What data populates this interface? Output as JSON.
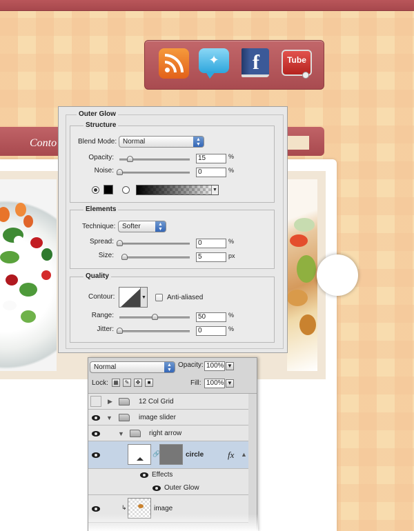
{
  "social": {
    "icons": [
      "rss-icon",
      "twitter-icon",
      "facebook-icon",
      "youtube-icon"
    ],
    "facebook_letter": "f",
    "youtube_label": "Tube"
  },
  "nav": {
    "label": "Conto"
  },
  "outer_glow": {
    "title": "Outer Glow",
    "structure": {
      "title": "Structure",
      "blend_mode_label": "Blend Mode:",
      "blend_mode_value": "Normal",
      "opacity_label": "Opacity:",
      "opacity_value": "15",
      "opacity_unit": "%",
      "noise_label": "Noise:",
      "noise_value": "0",
      "noise_unit": "%",
      "opacity_level": 0.15,
      "noise_level": 0
    },
    "elements": {
      "title": "Elements",
      "technique_label": "Technique:",
      "technique_value": "Softer",
      "spread_label": "Spread:",
      "spread_value": "0",
      "spread_unit": "%",
      "size_label": "Size:",
      "size_value": "5",
      "size_unit": "px"
    },
    "quality": {
      "title": "Quality",
      "contour_label": "Contour:",
      "anti_aliased_label": "Anti-aliased",
      "anti_aliased_checked": false,
      "range_label": "Range:",
      "range_value": "50",
      "range_unit": "%",
      "jitter_label": "Jitter:",
      "jitter_value": "0",
      "jitter_unit": "%"
    }
  },
  "layers": {
    "blend_mode": "Normal",
    "opacity_label": "Opacity:",
    "opacity_value": "100%",
    "lock_label": "Lock:",
    "fill_label": "Fill:",
    "fill_value": "100%",
    "rows": {
      "grid": "12 Col Grid",
      "image_slider": "image slider",
      "right_arrow": "right arrow",
      "circle": "circle",
      "fx": "fx",
      "effects": "Effects",
      "outer_glow": "Outer Glow",
      "image": "image"
    }
  }
}
